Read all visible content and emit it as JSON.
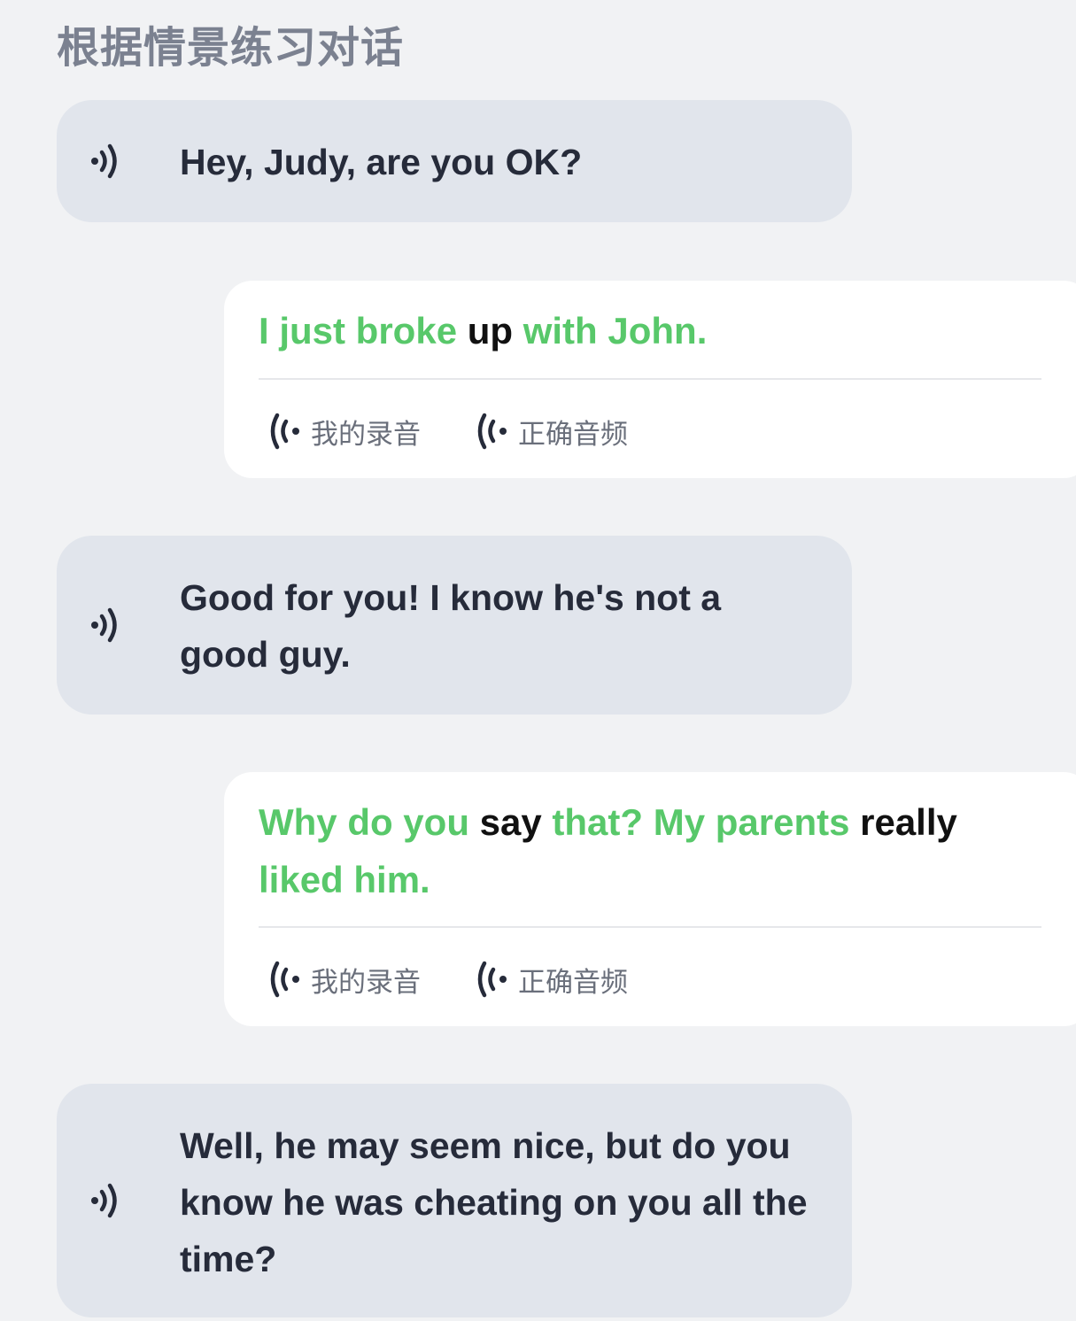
{
  "page": {
    "title": "根据情景练习对话"
  },
  "dialogue": [
    {
      "role": "prompt",
      "text": "Hey, Judy, are you OK?",
      "play_icon": "speaker-icon"
    },
    {
      "role": "reply",
      "words": [
        {
          "text": "I just broke",
          "status": "correct"
        },
        {
          "text": "up",
          "status": "incorrect"
        },
        {
          "text": "with John.",
          "status": "correct"
        }
      ],
      "my_recording_label": "我的录音",
      "correct_audio_label": "正确音频"
    },
    {
      "role": "prompt",
      "text": "Good for you! I know he's not a good guy.",
      "play_icon": "speaker-icon"
    },
    {
      "role": "reply",
      "words": [
        {
          "text": "Why do you",
          "status": "correct"
        },
        {
          "text": "say",
          "status": "incorrect"
        },
        {
          "text": "that? My parents",
          "status": "correct"
        },
        {
          "text": "really",
          "status": "incorrect"
        },
        {
          "text": "liked him.",
          "status": "correct"
        }
      ],
      "my_recording_label": "我的录音",
      "correct_audio_label": "正确音频"
    },
    {
      "role": "prompt",
      "text": "Well, he may seem nice, but do you know he was cheating on you all the time?",
      "play_icon": "speaker-icon"
    }
  ],
  "colors": {
    "correct_word": "#58c86a",
    "incorrect_word": "#111111",
    "prompt_bubble": "#e1e5ec",
    "reply_bubble": "#ffffff",
    "background": "#f1f2f4"
  }
}
